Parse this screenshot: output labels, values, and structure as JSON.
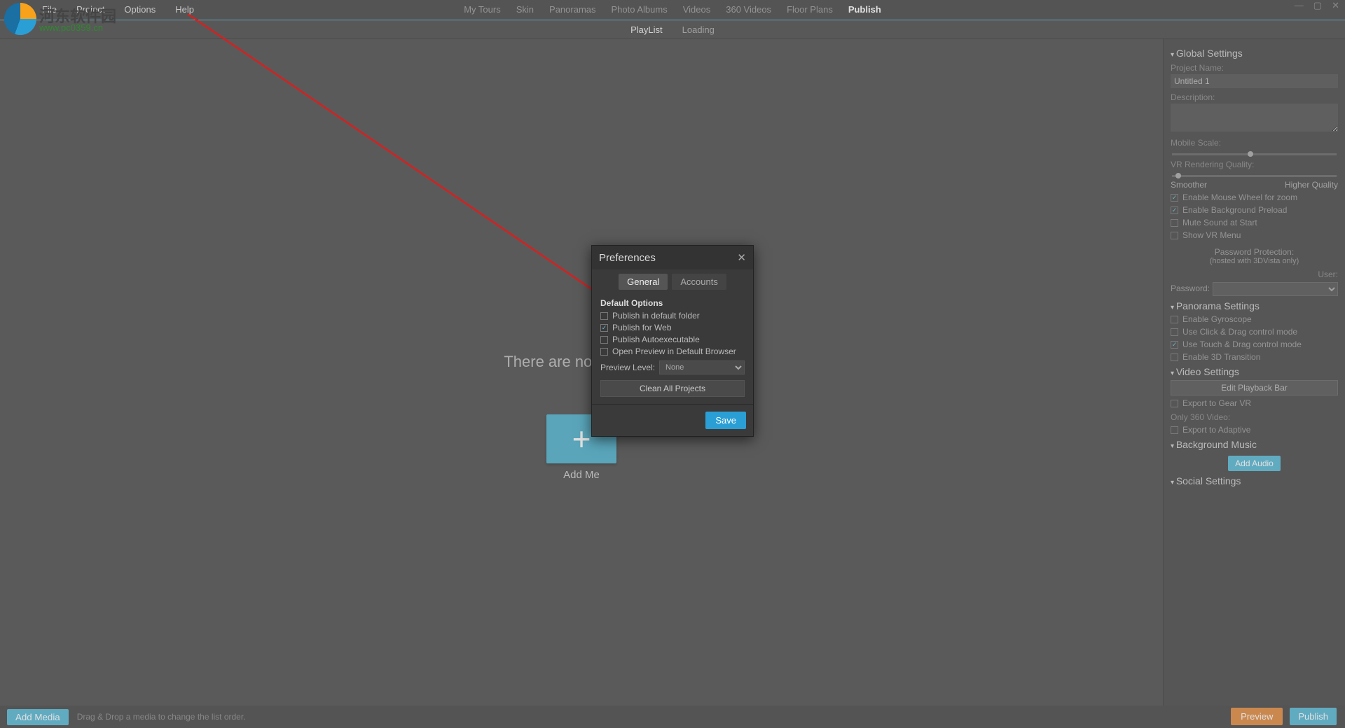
{
  "logo": {
    "chars": "河东软件园",
    "url": "www.pc0359.cn"
  },
  "menu": {
    "file": "File",
    "project": "Project",
    "options": "Options",
    "help": "Help"
  },
  "tabs": {
    "mytours": "My Tours",
    "skin": "Skin",
    "panoramas": "Panoramas",
    "photoalbums": "Photo Albums",
    "videos": "Videos",
    "v360": "360 Videos",
    "floorplans": "Floor Plans",
    "publish": "Publish"
  },
  "subtabs": {
    "playlist": "PlayList",
    "loading": "Loading"
  },
  "empty": {
    "msg": "There are no media ite",
    "add": "Add Me"
  },
  "dialog": {
    "title": "Preferences",
    "tab_general": "General",
    "tab_accounts": "Accounts",
    "section": "Default Options",
    "opt_pubfolder": "Publish in default folder",
    "opt_pubweb": "Publish for Web",
    "opt_pubauto": "Publish Autoexecutable",
    "opt_openprev": "Open Preview in Default Browser",
    "preview_label": "Preview Level:",
    "preview_value": "None",
    "clean": "Clean All Projects",
    "save": "Save"
  },
  "side": {
    "global": "Global Settings",
    "projname_lbl": "Project Name:",
    "projname_val": "Untitled 1",
    "desc_lbl": "Description:",
    "mobile_lbl": "Mobile Scale:",
    "vrq_lbl": "VR Rendering Quality:",
    "smoother": "Smoother",
    "higher": "Higher Quality",
    "ck_mouse": "Enable Mouse Wheel for zoom",
    "ck_preload": "Enable Background Preload",
    "ck_mute": "Mute Sound at Start",
    "ck_vrmenu": "Show VR Menu",
    "pw_title": "Password Protection:",
    "pw_sub": "(hosted with 3DVista only)",
    "pw_user": "User:",
    "pw_pass": "Password:",
    "pano": "Panorama Settings",
    "ck_gyro": "Enable Gyroscope",
    "ck_click": "Use Click & Drag control mode",
    "ck_touch": "Use Touch & Drag control mode",
    "ck_3d": "Enable 3D Transition",
    "video": "Video Settings",
    "editbar": "Edit Playback Bar",
    "ck_gear": "Export to Gear VR",
    "only360": "Only 360 Video:",
    "ck_adaptive": "Export to Adaptive",
    "bgmusic": "Background Music",
    "addaudio": "Add Audio",
    "social": "Social Settings"
  },
  "bottom": {
    "add": "Add Media",
    "hint": "Drag & Drop a media to change the list order.",
    "preview": "Preview",
    "publish": "Publish"
  }
}
